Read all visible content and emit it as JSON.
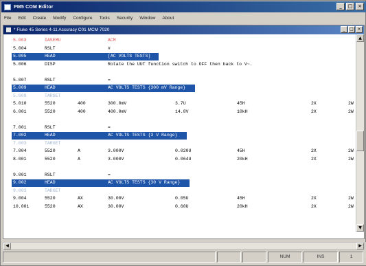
{
  "window": {
    "title": "PM5 COM Editor",
    "minimize": "_",
    "restore": "□",
    "close": "×"
  },
  "menu": [
    "File",
    "Edit",
    "Create",
    "Modify",
    "Configure",
    "Tools",
    "Security",
    "Window",
    "About"
  ],
  "document": {
    "title": "* Fluke 45 Series 4-11 Accuracy C01 MCM 7020",
    "minimize": "_",
    "restore": "□",
    "close": "×"
  },
  "lines": [
    {
      "num": "5.003",
      "c1": "IASEMU",
      "c2": "",
      "c3": "ACM",
      "c4": "",
      "c5": "",
      "c6": "",
      "c7": "",
      "style": "red"
    },
    {
      "num": "5.004",
      "c1": "RSLT",
      "c2": "",
      "c3": "#",
      "c4": "",
      "c5": "",
      "c6": "",
      "c7": "",
      "style": "normal"
    },
    {
      "num": "5.005",
      "c1": "HEAD",
      "c2": "",
      "c3": "[AC VOLTS TESTS]",
      "c4": "",
      "c5": "",
      "c6": "",
      "c7": "",
      "style": "hl"
    },
    {
      "num": "5.006",
      "c1": "DISP",
      "c2": "",
      "c3": "Rotate the UUT function switch to OFF then back to V~.",
      "c4": "",
      "c5": "",
      "c6": "",
      "c7": "",
      "style": "normal"
    },
    {
      "num": "",
      "c1": "",
      "c2": "",
      "c3": "",
      "c4": "",
      "c5": "",
      "c6": "",
      "c7": "",
      "style": "blank"
    },
    {
      "num": "5.007",
      "c1": "RSLT",
      "c2": "",
      "c3": "=",
      "c4": "",
      "c5": "",
      "c6": "",
      "c7": "",
      "style": "normal"
    },
    {
      "num": "5.009",
      "c1": "HEAD",
      "c2": "",
      "c3": "AC VOLTS TESTS {300 mV Range}",
      "c4": "",
      "c5": "",
      "c6": "",
      "c7": "",
      "style": "hl"
    },
    {
      "num": "5.009",
      "c1": "TARGET",
      "c2": "",
      "c3": "",
      "c4": "",
      "c5": "",
      "c6": "",
      "c7": "",
      "style": "faint"
    },
    {
      "num": "5.010",
      "c1": "5520",
      "c2": "400",
      "c3": "300.0mV",
      "c4": "3.7U",
      "c5": "45H",
      "c6": "2X",
      "c7": "2W",
      "style": "normal"
    },
    {
      "num": "6.001",
      "c1": "5520",
      "c2": "400",
      "c3": "400.0mV",
      "c4": "14.8V",
      "c5": "10kH",
      "c6": "2X",
      "c7": "2W",
      "style": "normal"
    },
    {
      "num": "",
      "c1": "",
      "c2": "",
      "c3": "",
      "c4": "",
      "c5": "",
      "c6": "",
      "c7": "",
      "style": "blank"
    },
    {
      "num": "7.001",
      "c1": "RSLT",
      "c2": "",
      "c3": "=",
      "c4": "",
      "c5": "",
      "c6": "",
      "c7": "",
      "style": "normal"
    },
    {
      "num": "7.002",
      "c1": "HEAD",
      "c2": "",
      "c3": "AC VOLTS TESTS {3 V Range}",
      "c4": "",
      "c5": "",
      "c6": "",
      "c7": "",
      "style": "hl"
    },
    {
      "num": "7.003",
      "c1": "TARGET",
      "c2": "",
      "c3": "",
      "c4": "",
      "c5": "",
      "c6": "",
      "c7": "",
      "style": "faint"
    },
    {
      "num": "7.004",
      "c1": "5520",
      "c2": "A",
      "c3": "3.000V",
      "c4": "0.020U",
      "c5": "45H",
      "c6": "2X",
      "c7": "2W",
      "style": "normal"
    },
    {
      "num": "8.001",
      "c1": "5520",
      "c2": "A",
      "c3": "3.000V",
      "c4": "0.064U",
      "c5": "20kH",
      "c6": "2X",
      "c7": "2W",
      "style": "normal"
    },
    {
      "num": "",
      "c1": "",
      "c2": "",
      "c3": "",
      "c4": "",
      "c5": "",
      "c6": "",
      "c7": "",
      "style": "blank"
    },
    {
      "num": "9.001",
      "c1": "RSLT",
      "c2": "",
      "c3": "=",
      "c4": "",
      "c5": "",
      "c6": "",
      "c7": "",
      "style": "normal"
    },
    {
      "num": "9.002",
      "c1": "HEAD",
      "c2": "",
      "c3": "AC VOLTS TESTS {30 V Range}",
      "c4": "",
      "c5": "",
      "c6": "",
      "c7": "",
      "style": "hl"
    },
    {
      "num": "9.003",
      "c1": "TARGET",
      "c2": "",
      "c3": "",
      "c4": "",
      "c5": "",
      "c6": "",
      "c7": "",
      "style": "faint"
    },
    {
      "num": "9.004",
      "c1": "5520",
      "c2": "AX",
      "c3": "30.00V",
      "c4": "0.05U",
      "c5": "45H",
      "c6": "2X",
      "c7": "2W",
      "style": "normal"
    },
    {
      "num": "10.001",
      "c1": "5520",
      "c2": "AX",
      "c3": "30.00V",
      "c4": "0.60U",
      "c5": "20kH",
      "c6": "2X",
      "c7": "2W",
      "style": "normal"
    }
  ],
  "status": {
    "p1": "",
    "p2": "",
    "p3": "",
    "mode": "NUM",
    "ins": "INS",
    "last": "1"
  },
  "colors": {
    "titlebar": "#0a246a",
    "highlight": "#1f55a8",
    "red_text": "#e05050",
    "faint_text": "#a0b4d4"
  }
}
